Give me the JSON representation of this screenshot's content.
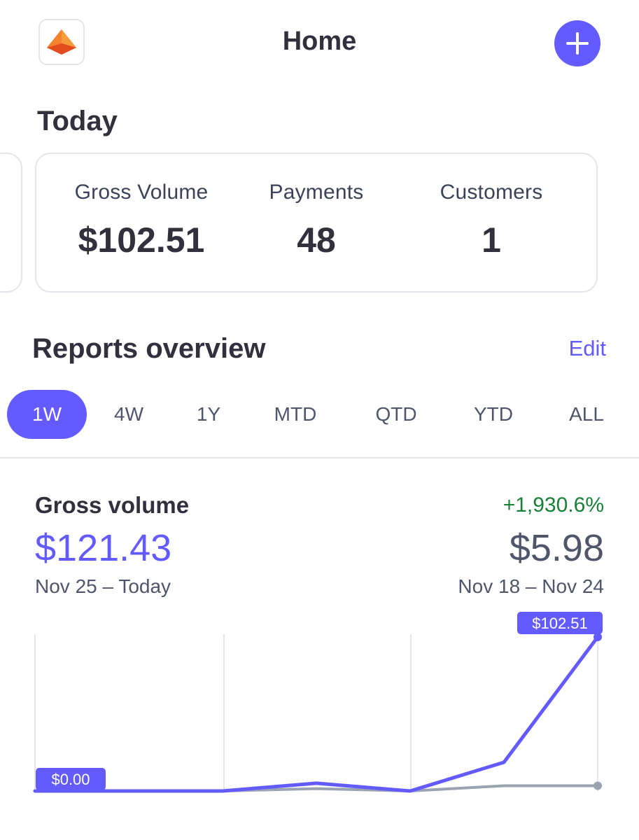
{
  "header": {
    "title": "Home",
    "logo_icon": "orange-pyramid-logo-icon",
    "add_icon": "plus-icon"
  },
  "today": {
    "title": "Today",
    "metrics": [
      {
        "label": "Gross Volume",
        "value": "$102.51"
      },
      {
        "label": "Payments",
        "value": "48"
      },
      {
        "label": "Customers",
        "value": "1"
      }
    ]
  },
  "reports": {
    "title": "Reports overview",
    "edit_label": "Edit",
    "ranges": [
      "1W",
      "4W",
      "1Y",
      "MTD",
      "QTD",
      "YTD",
      "ALL"
    ],
    "active_range": "1W"
  },
  "gross_volume": {
    "title": "Gross volume",
    "change": "+1,930.6%",
    "current_value": "$121.43",
    "previous_value": "$5.98",
    "current_range": "Nov 25 – Today",
    "previous_range": "Nov 18 – Nov 24"
  },
  "colors": {
    "accent": "#635bff",
    "positive": "#1a7f37",
    "comparison_line": "#9aa3b2",
    "border": "#e3e5ea"
  },
  "chart_data": {
    "type": "line",
    "x": [
      1,
      2,
      3,
      4,
      5,
      6,
      7
    ],
    "ylim": [
      0,
      102.51
    ],
    "grid": "vertical",
    "series": [
      {
        "key": "current",
        "values": [
          0,
          0,
          0,
          5.2,
          0,
          19.1,
          102.51
        ]
      },
      {
        "key": "previous",
        "values": [
          0,
          0,
          0,
          1.6,
          0,
          3.5,
          3.5
        ]
      }
    ],
    "labels": {
      "start": "$0.00",
      "end": "$102.51"
    }
  }
}
